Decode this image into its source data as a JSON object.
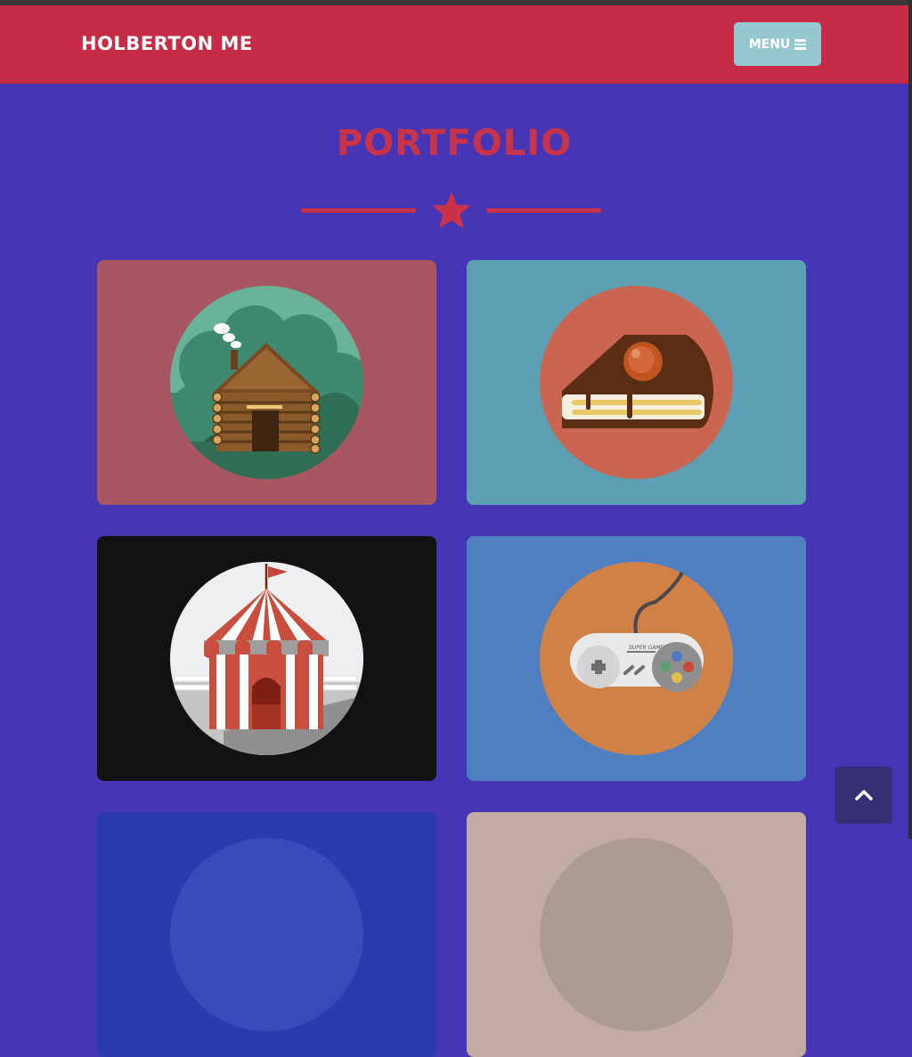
{
  "header": {
    "brand": "HOLBERTON ME",
    "menu_label": "MENU",
    "menu_icon": "bars-icon"
  },
  "portfolio": {
    "title": "PORTFOLIO",
    "divider_icon": "star-icon",
    "items": [
      {
        "icon": "log-cabin-icon",
        "bg": "#a85762"
      },
      {
        "icon": "cake-slice-icon",
        "bg": "#5d9fb3"
      },
      {
        "icon": "circus-tent-icon",
        "bg": "#131212"
      },
      {
        "icon": "game-controller-icon",
        "bg": "#4f7fc0"
      },
      {
        "icon": "portfolio-item-5",
        "bg": "#2b3aac"
      },
      {
        "icon": "portfolio-item-6",
        "bg": "#c1aba2"
      }
    ]
  },
  "controller": {
    "brand_text": "SUPER GAME"
  },
  "scroll": {
    "icon": "chevron-up-icon"
  },
  "colors": {
    "navbar": "#c62c45",
    "page_bg": "#4636b5",
    "accent": "#c8334a",
    "menu_button": "#96c8cf",
    "back_to_top": "#352f73"
  }
}
